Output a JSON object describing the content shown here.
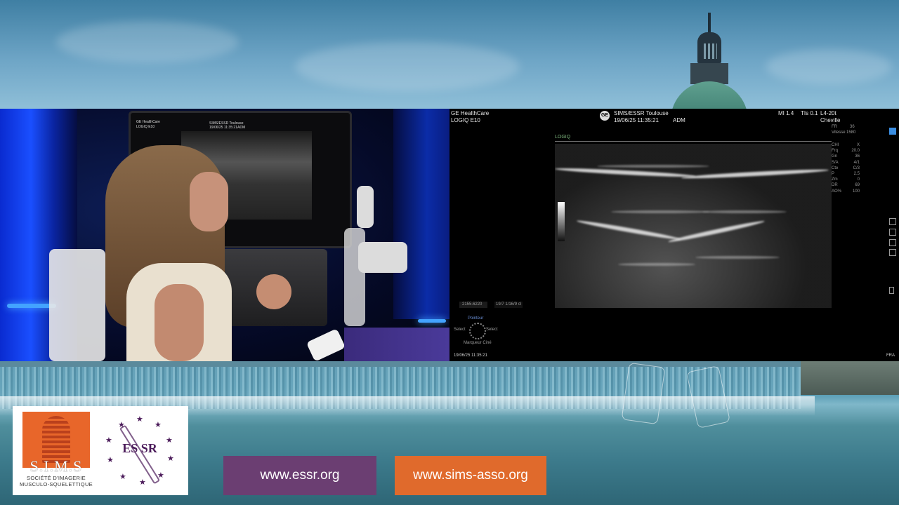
{
  "ultrasound": {
    "vendor": "GE HealthCare",
    "model": "LOGIQ E10",
    "header_title": "SIMS/ESSR Toulouse",
    "header_datetime": "19/06/25 11:35:21",
    "header_user": "ADM",
    "mi": "MI 1.4",
    "tis": "TIs 0.1",
    "probe": "L4-20t",
    "preset": "Cheville",
    "mode_label": "LOGIQ",
    "top_right_params": [
      {
        "k": "FR",
        "v": "36"
      },
      {
        "k": "Vitesse",
        "v": "1580"
      }
    ],
    "params": [
      {
        "k": "CHI",
        "v": "X"
      },
      {
        "k": "Frq",
        "v": "20.0"
      },
      {
        "k": "Gn",
        "v": "36"
      },
      {
        "k": "S/A",
        "v": "4/1"
      },
      {
        "k": "Cte",
        "v": "C/3"
      },
      {
        "k": "P",
        "v": "2.5"
      },
      {
        "k": "Zm",
        "v": "0"
      },
      {
        "k": "DR",
        "v": "69"
      },
      {
        "k": "AO%",
        "v": "100"
      }
    ],
    "left_tag1": "2155.6220",
    "left_tag2": "19/7 1/16/9 cl",
    "controls": {
      "top": "Pointeur",
      "left": "Select",
      "right": "Select",
      "bottom": "Marqueur Ciné"
    },
    "footer_datetime": "19/06/25 11:35:21",
    "footer_lang": "FRA",
    "colors": {
      "accent": "#3a8de0"
    }
  },
  "camera_monitor": {
    "vendor": "GE HealthCare",
    "model": "LOGIQ E10",
    "title": "SIMS/ESSR Toulouse",
    "datetime": "19/06/25 11:35:21",
    "user": "ADM"
  },
  "logos": {
    "sims": {
      "name": "S.I.M.S",
      "subtitle_line1": "SOCIÉTÉ D'IMAGERIE",
      "subtitle_line2": "MUSCULO-SQUELETTIQUE"
    },
    "essr": {
      "name": "ES SR"
    }
  },
  "links": {
    "essr": "www.essr.org",
    "sims": "www.sims-asso.org"
  },
  "colors": {
    "essr_purple": "#6b3e72",
    "sims_orange": "#e06a2c"
  }
}
